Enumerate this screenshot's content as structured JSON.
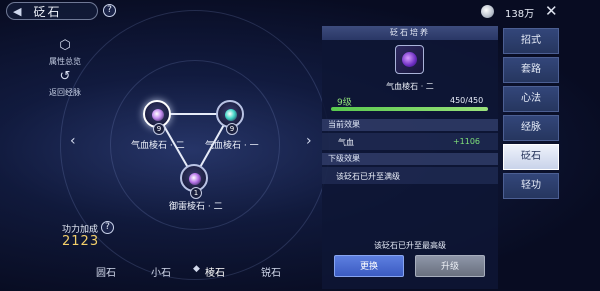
{
  "header": {
    "title": "砭石",
    "help": "?",
    "back_icon": "back-arrow-icon",
    "currency_icon": "silver-coin-icon",
    "currency_value": "138万",
    "close": "✕"
  },
  "tools": [
    {
      "label": "属性总览",
      "icon": "attribute-overview-icon"
    },
    {
      "label": "返回经脉",
      "icon": "return-meridian-icon"
    }
  ],
  "nodes": [
    {
      "label": "气血棱石 · 二",
      "level": "9",
      "color": "#c48cf0",
      "selected": true
    },
    {
      "label": "气血棱石 · 一",
      "level": "9",
      "color": "#44d6c8",
      "selected": false
    },
    {
      "label": "御雷棱石 · 二",
      "level": "1",
      "color": "#b774e8",
      "selected": false
    }
  ],
  "power": {
    "label": "功力加成",
    "help": "?",
    "value": "2123"
  },
  "stone_tabs": [
    "圆石",
    "小石",
    "棱石",
    "锐石"
  ],
  "active_stone_tab": 2,
  "panel": {
    "header": "砭石培养",
    "item_name": "气血棱石 · 二",
    "level": "9级",
    "exp": "450/450",
    "exp_fraction": 1.0,
    "current_title": "当前效果",
    "current_stat": "气血",
    "current_value": "+1106",
    "next_title": "下级效果",
    "next_text": "该砭石已升至满级",
    "max_text": "该砭石已升至最高级",
    "btn_replace": "更换",
    "btn_upgrade": "升级"
  },
  "right_tabs": [
    "招式",
    "套路",
    "心法",
    "经脉",
    "砭石",
    "轻功"
  ],
  "active_right_tab": 4
}
